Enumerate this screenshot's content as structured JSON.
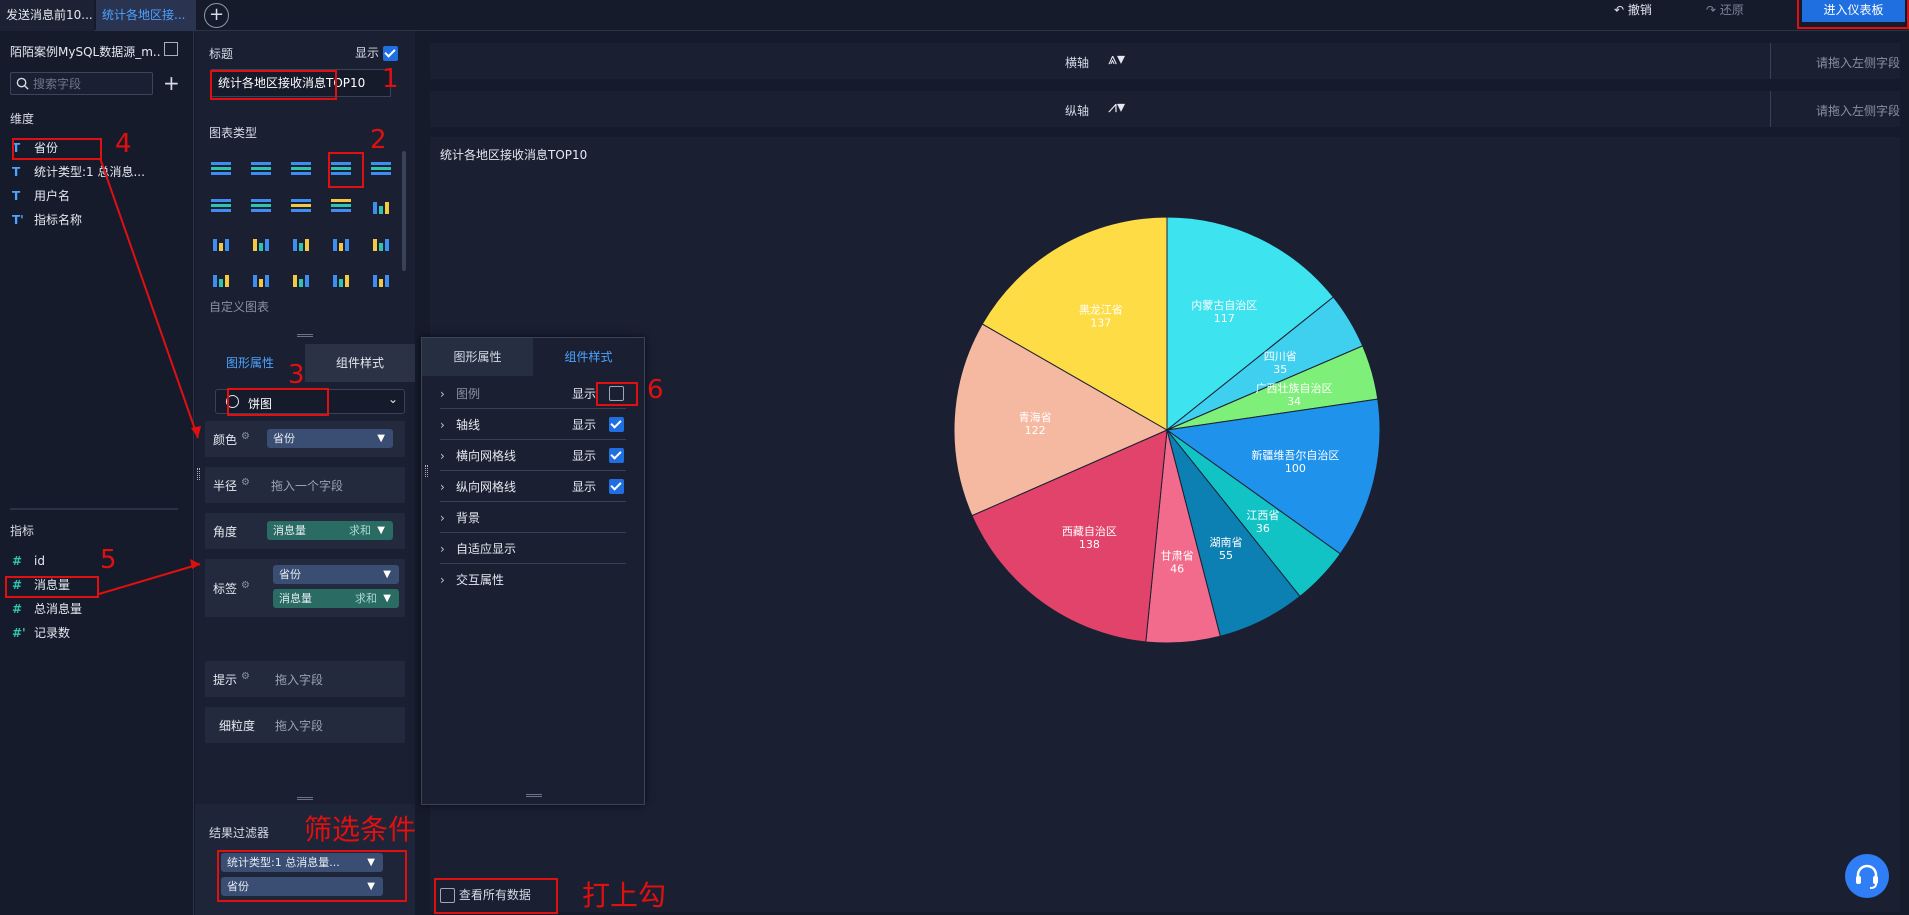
{
  "tabs": [
    {
      "label": "发送消息前10..."
    },
    {
      "label": "统计各地区接..."
    }
  ],
  "toolbar": {
    "undo": "撤销",
    "redo": "还原",
    "enter_dashboard": "进入仪表板"
  },
  "left": {
    "datasource": "陌陌案例MySQL数据源_m...",
    "search_placeholder": "搜索字段",
    "dimensions_title": "维度",
    "dimensions": [
      {
        "label": "省份",
        "type_icon": "T"
      },
      {
        "label": "统计类型:1 总消息...",
        "type_icon": "T"
      },
      {
        "label": "用户名",
        "type_icon": "T"
      },
      {
        "label": "指标名称",
        "type_icon": "T'"
      }
    ],
    "measures_title": "指标",
    "measures": [
      {
        "label": "id",
        "type_icon": "#"
      },
      {
        "label": "消息量",
        "type_icon": "#"
      },
      {
        "label": "总消息量",
        "type_icon": "#"
      },
      {
        "label": "记录数",
        "type_icon": "#'"
      }
    ]
  },
  "config": {
    "title_label": "标题",
    "show_label": "显示",
    "title_value": "统计各地区接收消息TOP10",
    "chart_types_label": "图表类型",
    "custom_chart": "自定义图表",
    "tab_shape": "图形属性",
    "tab_style": "组件样式",
    "chart_kind": "饼图",
    "rows": {
      "color": "颜色",
      "radius": "半径",
      "angle": "角度",
      "label": "标签",
      "tooltip": "提示",
      "granularity": "细粒度"
    },
    "color_field": "省份",
    "radius_placeholder": "拖入一个字段",
    "angle_field": "消息量",
    "angle_agg": "求和",
    "label_field1": "省份",
    "label_field2": "消息量",
    "label_agg": "求和",
    "tooltip_placeholder": "拖入字段",
    "granularity_placeholder": "拖入字段",
    "filter_title": "结果过滤器",
    "filters": [
      "统计类型:1 总消息量...",
      "省份"
    ]
  },
  "popover": {
    "tab_shape": "图形属性",
    "tab_style": "组件样式",
    "rows": [
      {
        "label": "图例",
        "show": "显示",
        "checked": false
      },
      {
        "label": "轴线",
        "show": "显示",
        "checked": true
      },
      {
        "label": "横向网格线",
        "show": "显示",
        "checked": true
      },
      {
        "label": "纵向网格线",
        "show": "显示",
        "checked": true
      },
      {
        "label": "背景",
        "show": "",
        "checked": null
      },
      {
        "label": "自适应显示",
        "show": "",
        "checked": null
      },
      {
        "label": "交互属性",
        "show": "",
        "checked": null
      }
    ]
  },
  "axes": {
    "x_label": "横轴",
    "y_label": "纵轴",
    "drop_hint": "请拖入左侧字段"
  },
  "chart_title": "统计各地区接收消息TOP10",
  "view_all": "查看所有数据",
  "annotations": {
    "n1": "1",
    "n2": "2",
    "n3": "3",
    "n4": "4",
    "n5": "5",
    "n6": "6",
    "filter_note": "筛选条件",
    "check_note": "打上勾"
  },
  "chart_data": {
    "type": "pie",
    "title": "统计各地区接收消息TOP10",
    "legend": false,
    "slices": [
      {
        "name": "内蒙古自治区",
        "value": 117,
        "color": "#3de3ef"
      },
      {
        "name": "四川省",
        "value": 35,
        "color": "#3fd0f0"
      },
      {
        "name": "广西壮族自治区",
        "value": 34,
        "color": "#7ef07a"
      },
      {
        "name": "新疆维吾尔自治区",
        "value": 100,
        "color": "#1f92ec"
      },
      {
        "name": "江西省",
        "value": 36,
        "color": "#12c3c6"
      },
      {
        "name": "湖南省",
        "value": 55,
        "color": "#0c7fb3"
      },
      {
        "name": "甘肃省",
        "value": 46,
        "color": "#f26b8c"
      },
      {
        "name": "西藏自治区",
        "value": 138,
        "color": "#e2436b"
      },
      {
        "name": "青海省",
        "value": 122,
        "color": "#f5b8a0"
      },
      {
        "name": "黑龙江省",
        "value": 137,
        "color": "#fedc45"
      }
    ]
  }
}
